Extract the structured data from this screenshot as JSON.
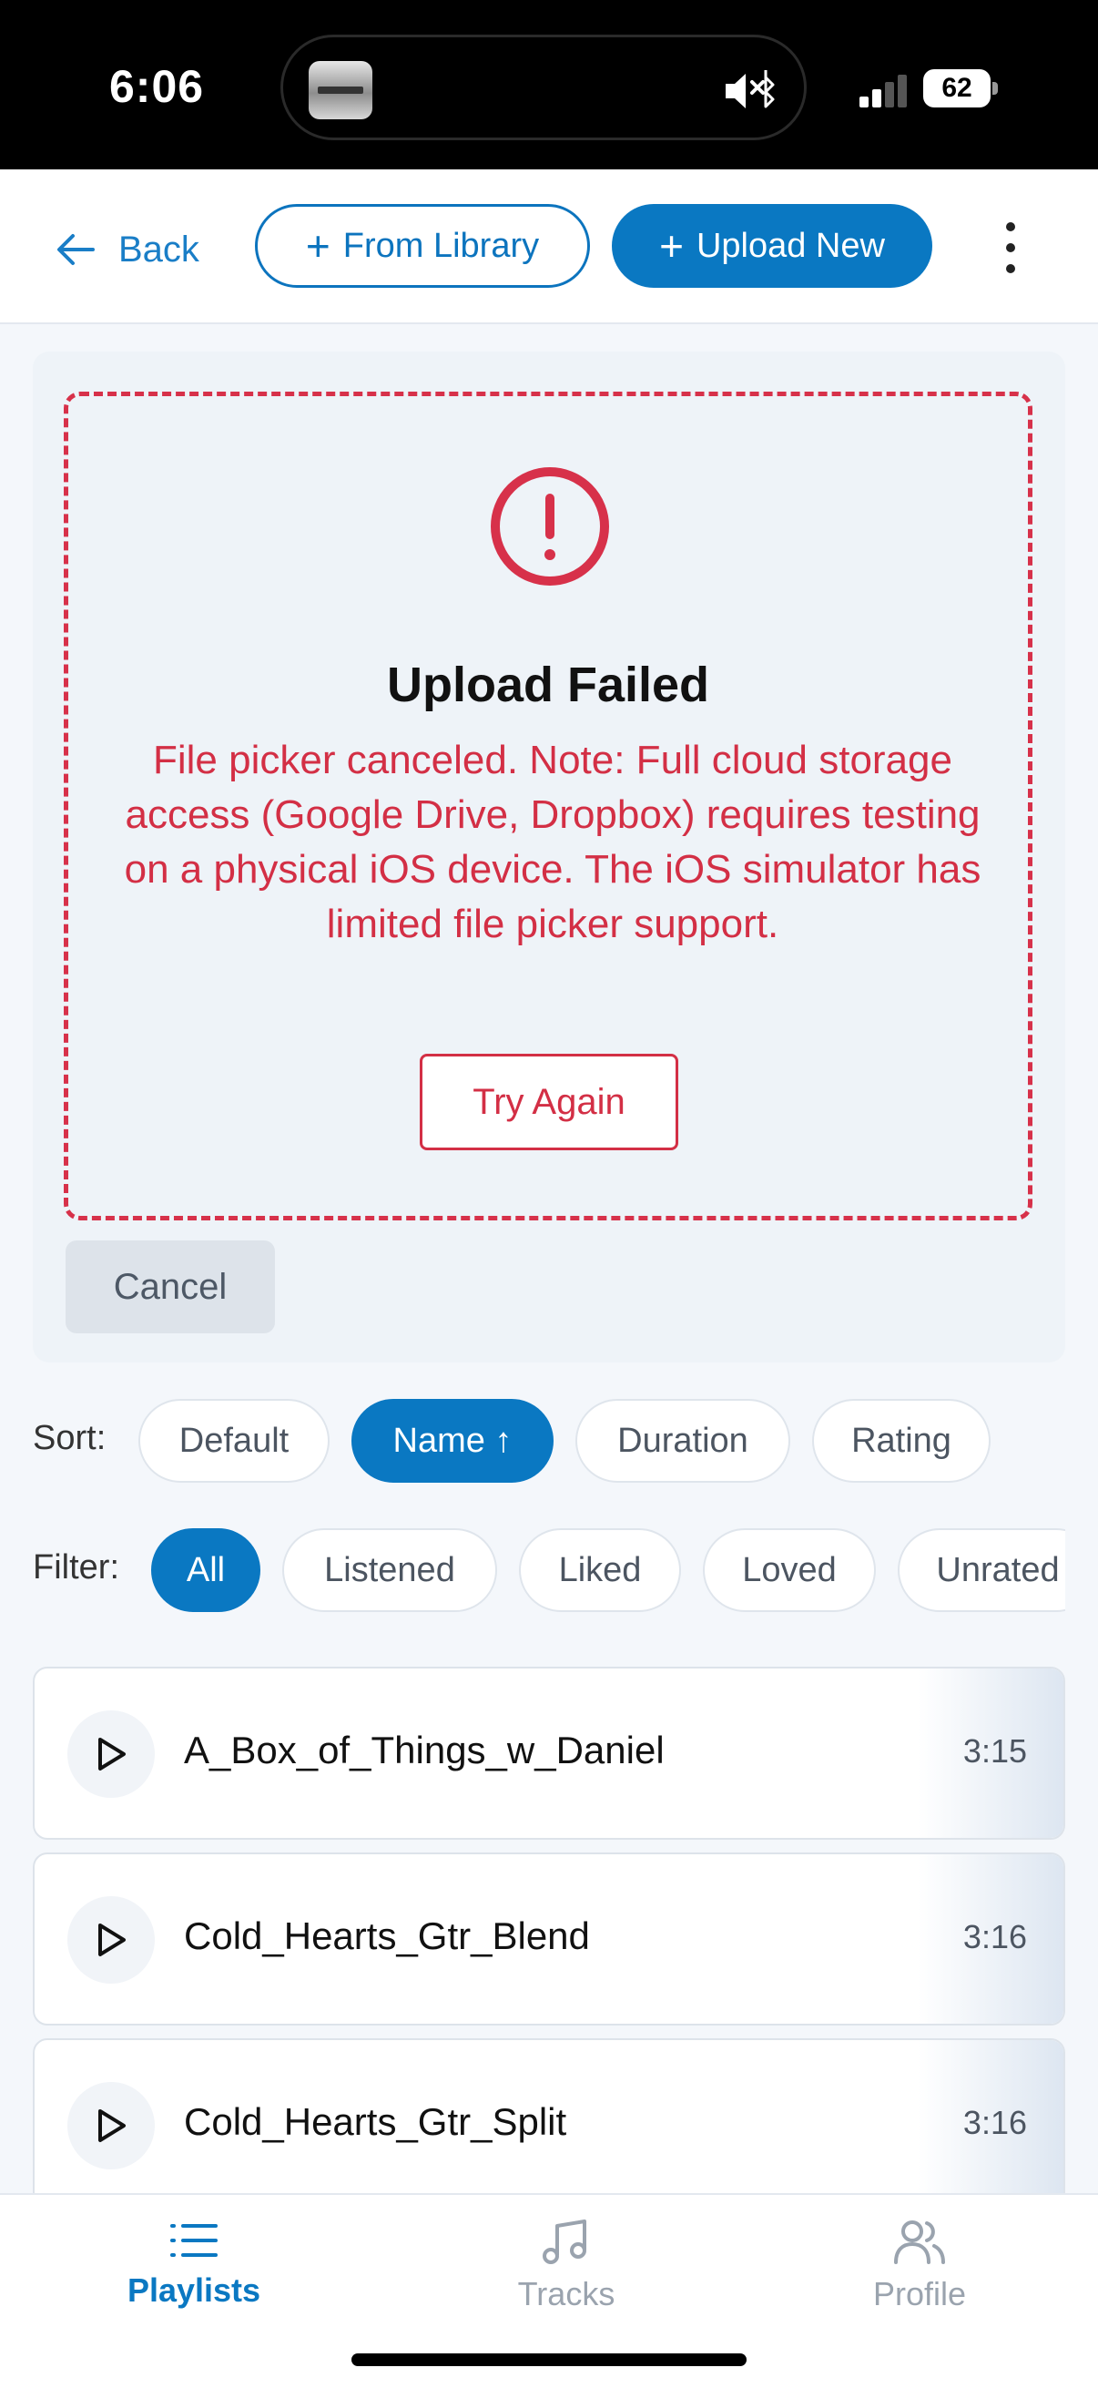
{
  "status_bar": {
    "time": "6:06",
    "battery": "62",
    "icons": [
      "media-thumbnail-icon",
      "mute-icon",
      "bluetooth-icon",
      "signal-icon",
      "battery-icon"
    ]
  },
  "header": {
    "back_label": "Back",
    "from_library_label": "From Library",
    "upload_new_label": "Upload New",
    "more_icon": "more-vertical-icon"
  },
  "upload_error": {
    "title": "Upload Failed",
    "message": "File picker canceled. Note: Full cloud storage access (Google Drive, Dropbox) requires testing on a physical iOS device. The iOS simulator has limited file picker support.",
    "retry_label": "Try Again",
    "cancel_label": "Cancel",
    "icon": "alert-circle-icon",
    "accent_color": "#d32f45"
  },
  "sort": {
    "label": "Sort:",
    "options": [
      "Default",
      "Name ↑",
      "Duration",
      "Rating"
    ],
    "selected": "Name ↑"
  },
  "filter": {
    "label": "Filter:",
    "options": [
      "All",
      "Listened",
      "Liked",
      "Loved",
      "Unrated"
    ],
    "selected": "All"
  },
  "tracks": [
    {
      "name": "A_Box_of_Things_w_Daniel",
      "duration": "3:15"
    },
    {
      "name": "Cold_Hearts_Gtr_Blend",
      "duration": "3:16"
    },
    {
      "name": "Cold_Hearts_Gtr_Split",
      "duration": "3:16"
    }
  ],
  "tab_bar": {
    "tabs": [
      {
        "label": "Playlists",
        "icon": "list-icon"
      },
      {
        "label": "Tracks",
        "icon": "music-note-icon"
      },
      {
        "label": "Profile",
        "icon": "users-icon"
      }
    ],
    "active": "Playlists"
  },
  "colors": {
    "primary": "#0a78c2",
    "error": "#d32f45",
    "background": "#f4f7fb"
  }
}
